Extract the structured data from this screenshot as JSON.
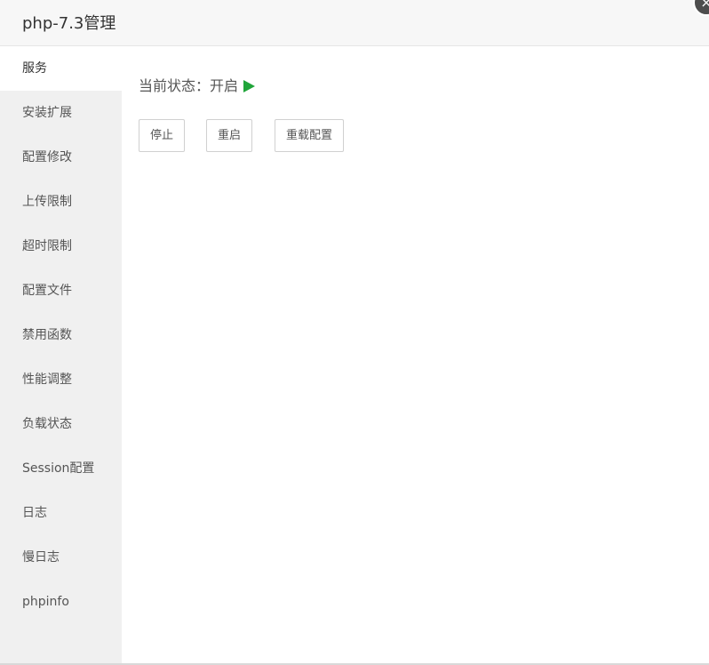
{
  "dialog": {
    "title": "php-7.3管理",
    "close_icon": "×"
  },
  "sidebar": {
    "items": [
      {
        "label": "服务",
        "active": true
      },
      {
        "label": "安装扩展"
      },
      {
        "label": "配置修改"
      },
      {
        "label": "上传限制"
      },
      {
        "label": "超时限制"
      },
      {
        "label": "配置文件"
      },
      {
        "label": "禁用函数"
      },
      {
        "label": "性能调整"
      },
      {
        "label": "负载状态"
      },
      {
        "label": "Session配置"
      },
      {
        "label": "日志"
      },
      {
        "label": "慢日志"
      },
      {
        "label": "phpinfo"
      }
    ]
  },
  "main": {
    "status_label": "当前状态：",
    "status_value": "开启",
    "status_icon": "play-icon",
    "status_color": "#20a53a",
    "buttons": {
      "stop": "停止",
      "restart": "重启",
      "reload": "重载配置"
    }
  }
}
